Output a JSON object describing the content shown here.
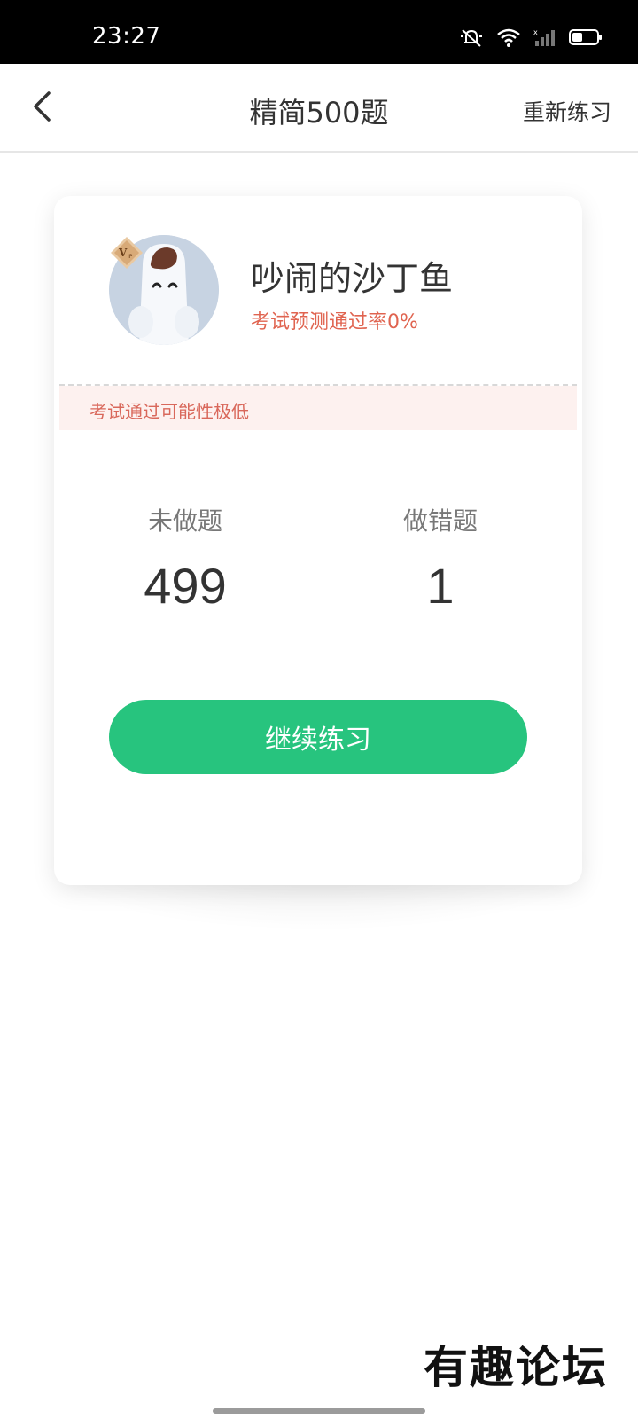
{
  "status_bar": {
    "time": "23:27",
    "icons": [
      "bell-muted-icon",
      "wifi-icon",
      "signal-icon",
      "battery-icon"
    ]
  },
  "header": {
    "back_icon": "chevron-left-icon",
    "title": "精简500题",
    "reset_label": "重新练习"
  },
  "profile": {
    "name": "吵闹的沙丁鱼",
    "pass_rate_text": "考试预测通过率0%",
    "badge": "VIP"
  },
  "warning": {
    "text": "考试通过可能性极低"
  },
  "stats": {
    "undone": {
      "label": "未做题",
      "value": "499"
    },
    "wrong": {
      "label": "做错题",
      "value": "1"
    }
  },
  "actions": {
    "continue_label": "继续练习"
  },
  "watermark": {
    "text": "有趣论坛"
  },
  "colors": {
    "accent": "#27c47e",
    "warning": "#e06450",
    "warning_bg": "#fdf1ef"
  }
}
